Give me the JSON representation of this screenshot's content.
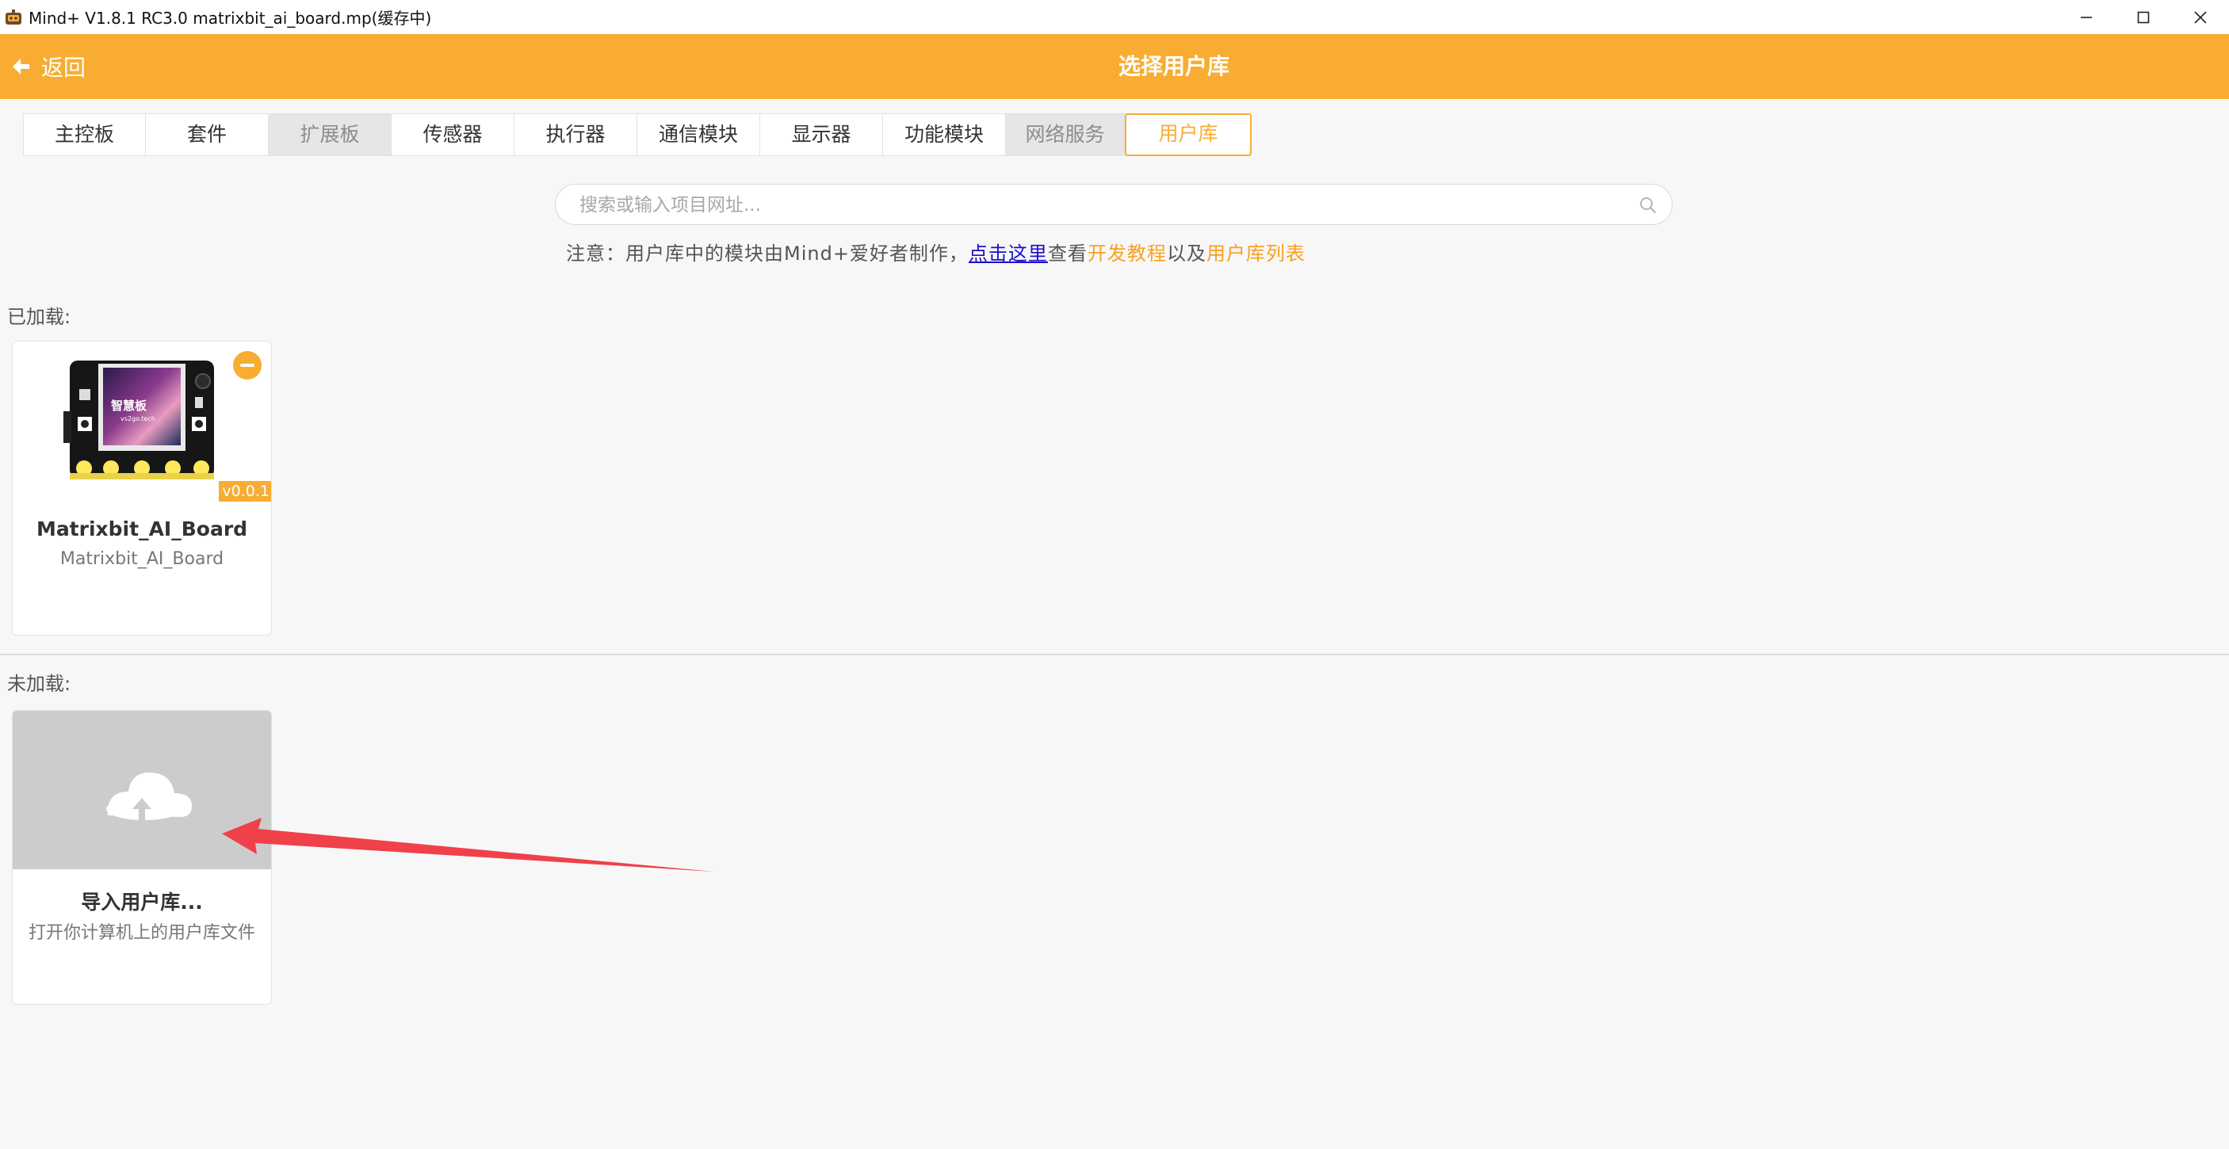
{
  "window": {
    "title": "Mind+ V1.8.1 RC3.0   matrixbit_ai_board.mp(缓存中)"
  },
  "header": {
    "back_label": "返回",
    "title": "选择用户库",
    "color": "#f8ad32"
  },
  "tabs": [
    {
      "label": "主控板",
      "state": "normal"
    },
    {
      "label": "套件",
      "state": "normal"
    },
    {
      "label": "扩展板",
      "state": "disabled"
    },
    {
      "label": "传感器",
      "state": "normal"
    },
    {
      "label": "执行器",
      "state": "normal"
    },
    {
      "label": "通信模块",
      "state": "normal"
    },
    {
      "label": "显示器",
      "state": "normal"
    },
    {
      "label": "功能模块",
      "state": "normal"
    },
    {
      "label": "网络服务",
      "state": "disabled"
    },
    {
      "label": "用户库",
      "state": "active"
    }
  ],
  "search": {
    "placeholder": "搜索或输入项目网址...",
    "value": ""
  },
  "notice": {
    "prefix": "注意：用户库中的模块由Mind+爱好者制作，",
    "link_click_here": "点击这里",
    "view": "查看",
    "link_dev_tutorial": "开发教程",
    "and": "以及",
    "link_library_list": "用户库列表"
  },
  "loaded": {
    "label": "已加载:",
    "items": [
      {
        "name": "Matrixbit_AI_Board",
        "subtitle": "Matrixbit_AI_Board",
        "version": "v0.0.1",
        "image_text": "智慧板",
        "image_subtext": "vs2go.tech"
      }
    ]
  },
  "unloaded": {
    "label": "未加载:",
    "import_card": {
      "title": "导入用户库...",
      "subtitle": "打开你计算机上的用户库文件"
    }
  },
  "icons": {
    "back": "arrow-left-icon",
    "search": "search-icon",
    "upload": "cloud-upload-icon",
    "remove": "minus-circle-icon",
    "minimize": "minimize-icon",
    "maximize": "maximize-icon",
    "close": "close-icon"
  },
  "colors": {
    "accent": "#f8ad32",
    "link_blue": "#1a0dcc",
    "link_orange": "#f8a01e",
    "annotation_arrow": "#f0404a"
  }
}
